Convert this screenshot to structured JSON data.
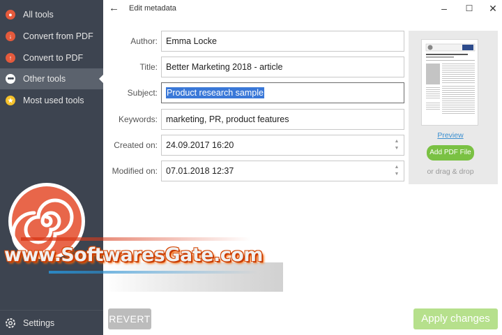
{
  "sidebar": {
    "items": [
      {
        "label": "All tools",
        "icon": "all-tools-icon"
      },
      {
        "label": "Convert from PDF",
        "icon": "convert-from-pdf-icon"
      },
      {
        "label": "Convert to PDF",
        "icon": "convert-to-pdf-icon"
      },
      {
        "label": "Other tools",
        "icon": "other-tools-icon",
        "active": true
      },
      {
        "label": "Most used tools",
        "icon": "star-icon"
      }
    ],
    "settings_label": "Settings",
    "bg_color": "#3d4450",
    "accent_color": "#e55a3c"
  },
  "header": {
    "title": "Edit metadata"
  },
  "form": {
    "author": {
      "label": "Author:",
      "value": "Emma Locke"
    },
    "title": {
      "label": "Title:",
      "value": "Better Marketing 2018 - article"
    },
    "subject": {
      "label": "Subject:",
      "value": "Product research sample",
      "selected": true
    },
    "keywords": {
      "label": "Keywords:",
      "value": "marketing, PR, product features"
    },
    "created": {
      "label": "Created on:",
      "value": "24.09.2017 16:20"
    },
    "modified": {
      "label": "Modified on:",
      "value": "07.01.2018 12:37"
    }
  },
  "preview": {
    "link_label": "Preview",
    "add_button": "Add PDF File",
    "drag_hint": "or drag & drop"
  },
  "watermark": {
    "text": "www.SoftwaresGate.com"
  },
  "footer": {
    "revert_label": "REVERT",
    "apply_label": "Apply changes",
    "apply_color": "#b6e08c"
  }
}
